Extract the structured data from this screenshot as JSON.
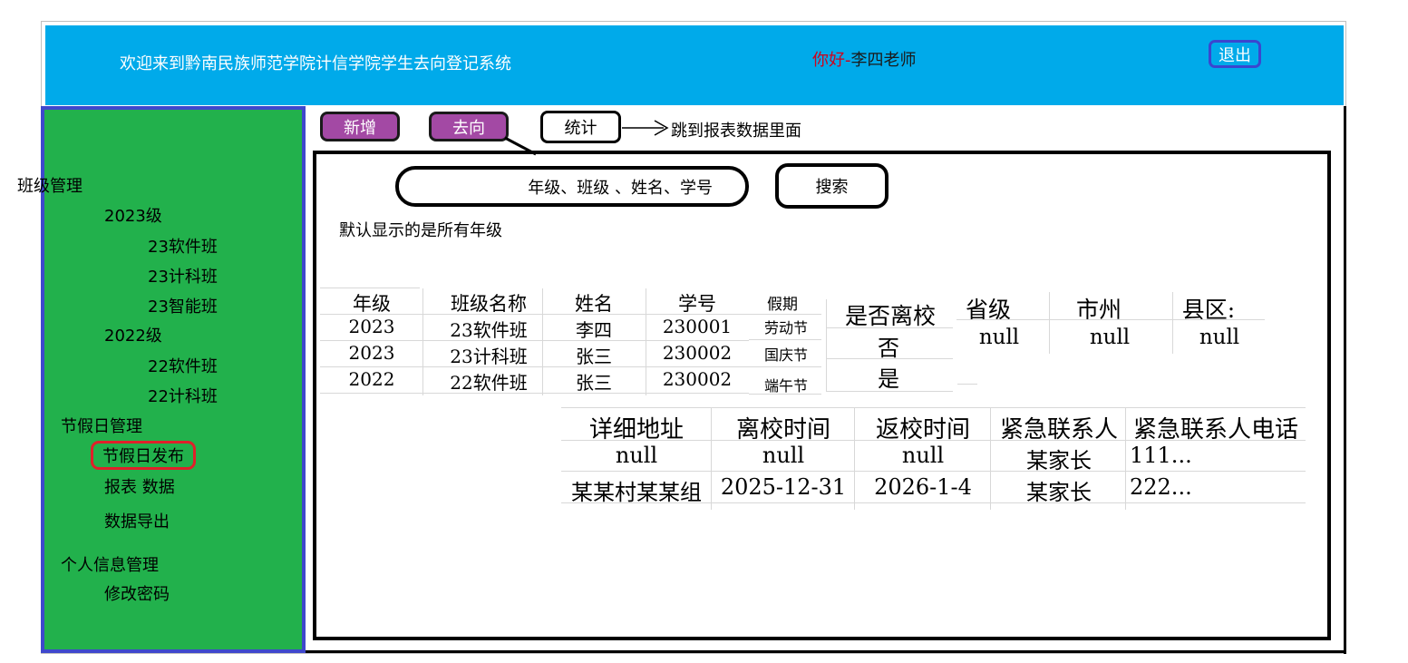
{
  "header": {
    "title": "欢迎来到黔南民族师范学院计信学院学生去向登记系统",
    "greeting_prefix": "你好-",
    "greeting_user": "李四老师",
    "logout_label": "退出"
  },
  "sidebar": {
    "class_mgmt": "班级管理",
    "grade_2023": "2023级",
    "class_23_soft": "23软件班",
    "class_23_cs": "23计科班",
    "class_23_ai": "23智能班",
    "grade_2022": "2022级",
    "class_22_soft": "22软件班",
    "class_22_cs": "22计科班",
    "holiday_mgmt": "节假日管理",
    "holiday_publish": "节假日发布",
    "report_data": "报表 数据",
    "data_export": "数据导出",
    "personal_mgmt": "个人信息管理",
    "change_password": "修改密码"
  },
  "toolbar": {
    "add_label": "新增",
    "whereabouts_label": "去向",
    "stats_label": "统计",
    "stats_note": "跳到报表数据里面"
  },
  "search": {
    "placeholder": "年级、班级 、姓名、学号",
    "button_label": "搜索",
    "default_note": "默认显示的是所有年级"
  },
  "table1": {
    "headers": [
      "年级",
      "班级名称",
      "姓名",
      "学号"
    ],
    "rows": [
      [
        "2023",
        "23软件班",
        "李四",
        "230001"
      ],
      [
        "2023",
        "23计科班",
        "张三",
        "230002"
      ],
      [
        "2022",
        "22软件班",
        "张三",
        "230002"
      ]
    ]
  },
  "holiday": {
    "header": "假期",
    "rows": [
      "劳动节",
      "国庆节",
      "端午节"
    ]
  },
  "left_school": {
    "header": "是否离校",
    "rows": [
      "否",
      "是"
    ]
  },
  "region": {
    "headers": [
      "省级",
      "市州",
      "县区:"
    ],
    "row": [
      "null",
      "null",
      "null"
    ]
  },
  "table2": {
    "headers": [
      "详细地址",
      "离校时间",
      "返校时间",
      "紧急联系人",
      "紧急联系人电话"
    ],
    "rows": [
      [
        "null",
        "null",
        "null",
        "某家长",
        "111..."
      ],
      [
        "某某村某某组",
        "2025-12-31",
        "2026-1-4",
        "某家长",
        "222..."
      ]
    ]
  },
  "colors": {
    "header_bg": "#00aaea",
    "sidebar_bg": "#22b14c",
    "sidebar_border": "#3f48cc",
    "purple_button": "#a349a4",
    "active_highlight": "#e0202a"
  }
}
